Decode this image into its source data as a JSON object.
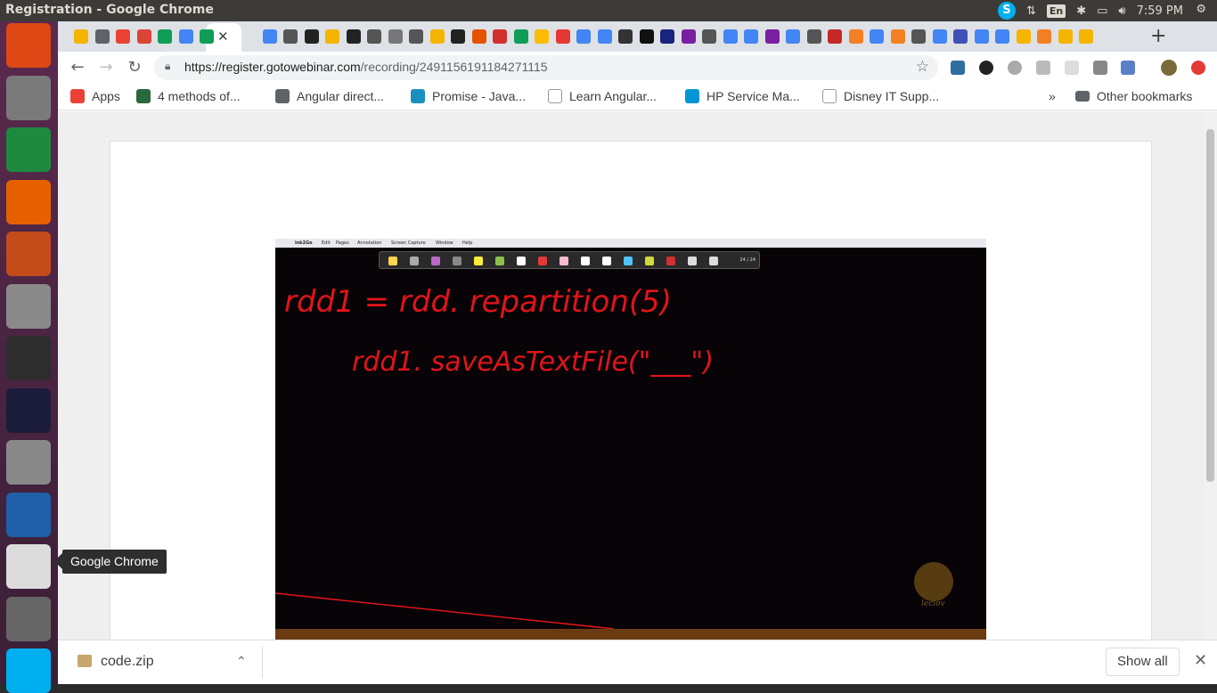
{
  "system": {
    "window_title": "Registration - Google Chrome",
    "language": "En",
    "clock": "7:59 PM",
    "skype_letter": "S"
  },
  "launcher": {
    "tooltip": "Google Chrome",
    "items": [
      {
        "name": "ubuntu-dash",
        "color": "#dd4814"
      },
      {
        "name": "files",
        "color": "#7a7a7a"
      },
      {
        "name": "libreoffice-calc",
        "color": "#1e8a3f"
      },
      {
        "name": "firefox",
        "color": "#e66000"
      },
      {
        "name": "libreoffice-impress",
        "color": "#c44b1a"
      },
      {
        "name": "system-settings",
        "color": "#8a8a8a"
      },
      {
        "name": "terminal",
        "color": "#2d2d2d"
      },
      {
        "name": "intellij-idea",
        "color": "#1b1b3a"
      },
      {
        "name": "help",
        "color": "#888888"
      },
      {
        "name": "libreoffice-writer",
        "color": "#1f5fa8"
      },
      {
        "name": "google-chrome",
        "color": "#dcdcdc"
      },
      {
        "name": "software-updater",
        "color": "#666666"
      },
      {
        "name": "skype",
        "color": "#00aff0"
      }
    ]
  },
  "browser": {
    "url_host": "https://register.gotowebinar.com",
    "url_path": "/recording/2491156191184271115",
    "new_tab": "+",
    "bookmarks": [
      {
        "label": "Apps",
        "color": "#e94235"
      },
      {
        "label": "4 methods of...",
        "color": "#2a6a3a"
      },
      {
        "label": "Angular direct...",
        "color": "#5f6368"
      },
      {
        "label": "Promise - Java...",
        "color": "#1a8fbf"
      },
      {
        "label": "Learn Angular...",
        "color": "#ffffff"
      },
      {
        "label": "HP Service Ma...",
        "color": "#0096d6"
      },
      {
        "label": "Disney IT Supp...",
        "color": "#ffffff"
      }
    ],
    "bookmarks_more": "»",
    "other_bookmarks": "Other bookmarks"
  },
  "video": {
    "app_name": "ink2Go",
    "menu": [
      "Edit",
      "Pages",
      "Annotation",
      "Screen Capture",
      "Window",
      "Help"
    ],
    "page_counter": "24 / 24",
    "handwriting_line1": "rdd1 = rdd. repartition(5)",
    "handwriting_line2": "rdd1. saveAsTextFile(\"___\")",
    "watermark": "leclov"
  },
  "downloads": {
    "file": "code.zip",
    "show_all": "Show all"
  },
  "colors": {
    "ink": "#e0141a",
    "chrome_tabstrip": "#dee1e6"
  }
}
